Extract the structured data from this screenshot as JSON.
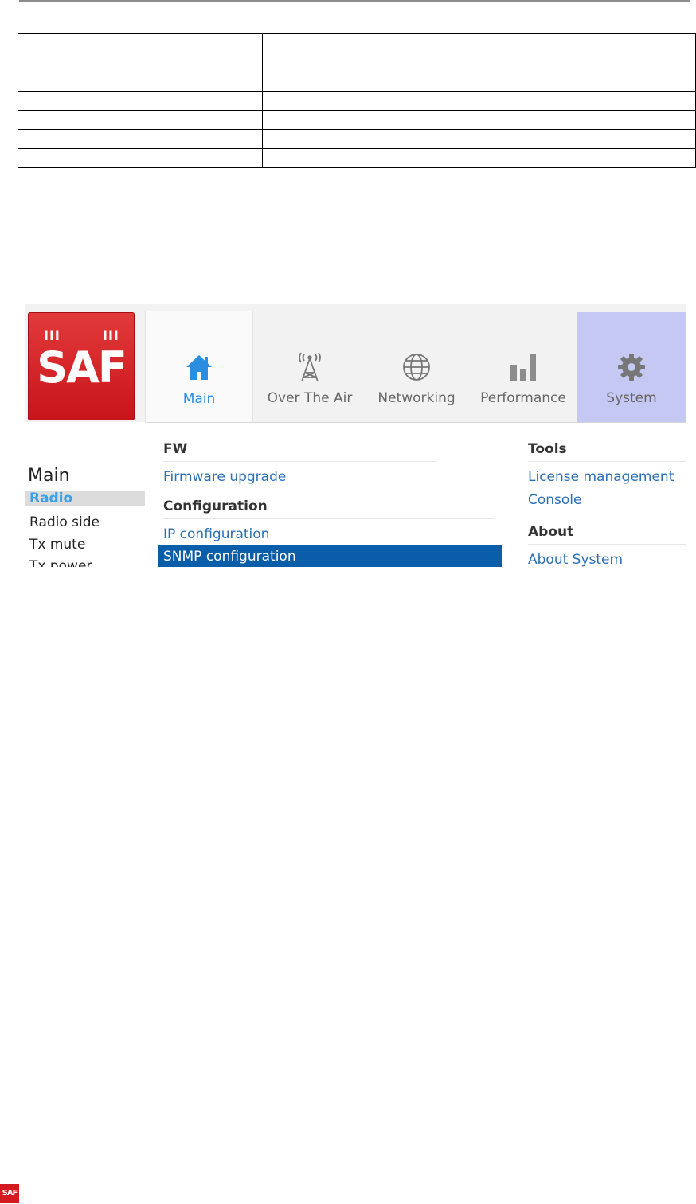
{
  "doc_table": {
    "rows": 7,
    "cols": 2
  },
  "logo": {
    "text": "SAF",
    "bars": "III",
    "color": "#d31a20"
  },
  "tabs": [
    {
      "label": "Main",
      "icon": "home-icon",
      "active": true
    },
    {
      "label": "Over The Air",
      "icon": "antenna-tower-icon"
    },
    {
      "label": "Networking",
      "icon": "globe-icon"
    },
    {
      "label": "Performance",
      "icon": "bar-chart-icon"
    },
    {
      "label": "System",
      "icon": "gear-icon",
      "highlighted": true
    }
  ],
  "sidebar": {
    "title": "Main",
    "items": [
      "Radio",
      "Radio side",
      "Tx mute",
      "Tx power"
    ],
    "active_item": "Radio"
  },
  "menu": {
    "fw_header": "FW",
    "fw_items": [
      "Firmware upgrade"
    ],
    "config_header": "Configuration",
    "config_items": [
      "IP configuration",
      "SNMP configuration"
    ],
    "selected_item": "SNMP configuration",
    "tools_header": "Tools",
    "tools_items": [
      "License management",
      "Console"
    ],
    "about_header": "About",
    "about_items": [
      "About System"
    ]
  },
  "colors": {
    "accent": "#2a8de0",
    "link": "#2a6fb6",
    "selected_bg": "#0a5da8",
    "system_tab_bg": "#c6c8f4"
  }
}
